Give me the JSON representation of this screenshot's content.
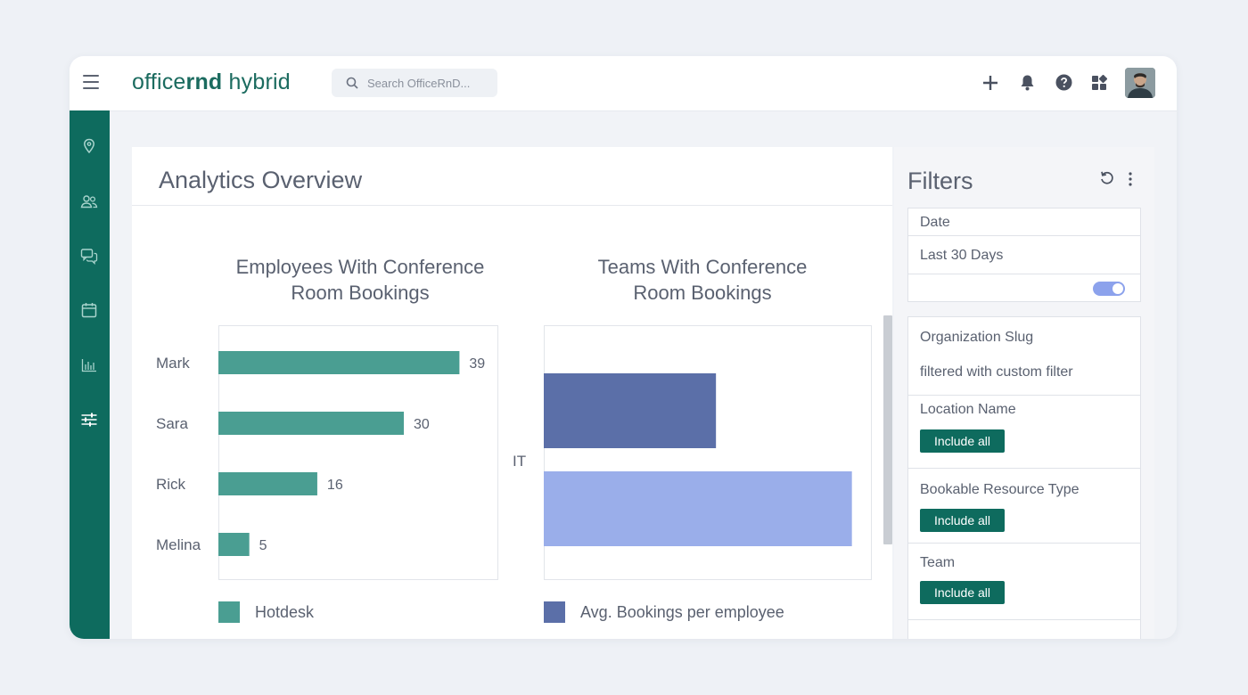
{
  "app": {
    "logo_regular": "office",
    "logo_bold": "rnd",
    "logo_suffix": " hybrid",
    "search_placeholder": "Search OfficeRnD...",
    "top_icons": [
      "plus-icon",
      "bell-icon",
      "help-icon",
      "apps-grid-icon",
      "user-avatar"
    ],
    "sidebar_icons": [
      "location-pin-icon",
      "people-icon",
      "chat-icon",
      "calendar-icon",
      "bar-chart-icon",
      "sliders-icon"
    ]
  },
  "page": {
    "title": "Analytics Overview"
  },
  "charts": {
    "employees": {
      "title_line1": "Employees With Conference",
      "title_line2": "Room Bookings",
      "legend": "Hotdesk"
    },
    "teams": {
      "title_line1": "Teams With Conference",
      "title_line2": "Room Bookings",
      "legend": "Avg. Bookings per employee"
    }
  },
  "chart_data": [
    {
      "type": "bar",
      "orientation": "horizontal",
      "title": "Employees With Conference Room Bookings",
      "categories": [
        "Mark",
        "Sara",
        "Rick",
        "Melina"
      ],
      "series": [
        {
          "name": "Hotdesk",
          "values": [
            39,
            30,
            16,
            5
          ]
        }
      ],
      "data_labels": true,
      "xlim": [
        0,
        45
      ],
      "color": "#4a9e92",
      "legend": "bottom-left"
    },
    {
      "type": "bar",
      "orientation": "horizontal",
      "title": "Teams With Conference Room Bookings",
      "categories": [
        "IT"
      ],
      "series": [
        {
          "name": "Avg. Bookings per employee",
          "values": [
            1.9
          ]
        },
        {
          "name": "",
          "values": [
            3.4
          ]
        }
      ],
      "xlim": [
        0,
        3.6
      ],
      "colors": [
        "#5b6fa8",
        "#9aaeea"
      ],
      "legend": "bottom-left"
    }
  ],
  "filters": {
    "title": "Filters",
    "date_label": "Date",
    "date_value": "Last 30 Days",
    "toggle_on": true,
    "org_label": "Organization Slug",
    "org_value": "filtered with custom filter",
    "location_label": "Location Name",
    "location_button": "Include all",
    "resource_label": "Bookable Resource Type",
    "resource_button": "Include all",
    "team_label": "Team",
    "team_button": "Include all"
  },
  "colors": {
    "brand": "#0e6b5e",
    "bar_green": "#4a9e92",
    "bar_blue_dark": "#5b6fa8",
    "bar_blue_light": "#9aaeea",
    "toggle": "#8ca2ec"
  }
}
